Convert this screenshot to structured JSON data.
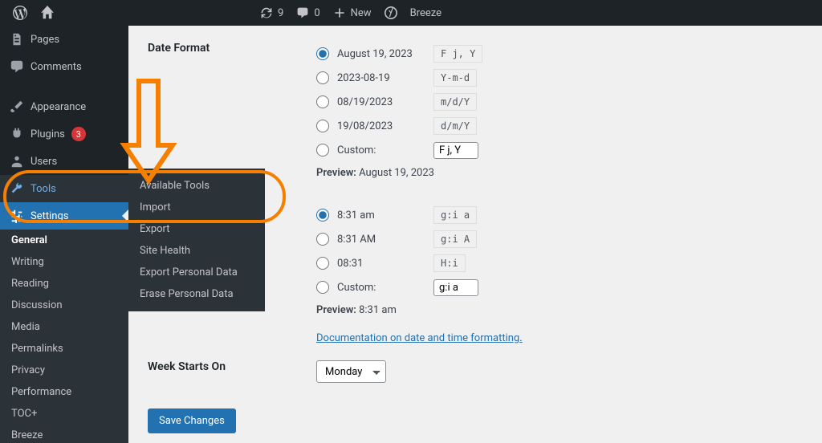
{
  "adminbar": {
    "updates_count": "9",
    "comments_count": "0",
    "new_label": "New",
    "yoast": "Y",
    "breeze": "Breeze"
  },
  "sidebar": {
    "pages": "Pages",
    "comments": "Comments",
    "appearance": "Appearance",
    "plugins": "Plugins",
    "plugins_badge": "3",
    "users": "Users",
    "tools": "Tools",
    "settings": "Settings",
    "sub": {
      "general": "General",
      "writing": "Writing",
      "reading": "Reading",
      "discussion": "Discussion",
      "media": "Media",
      "permalinks": "Permalinks",
      "privacy": "Privacy",
      "performance": "Performance",
      "tocplus": "TOC+",
      "breeze": "Breeze"
    }
  },
  "tools_flyout": {
    "available": "Available Tools",
    "import": "Import",
    "export": "Export",
    "site_health": "Site Health",
    "export_personal": "Export Personal Data",
    "erase_personal": "Erase Personal Data"
  },
  "content": {
    "date_format_label": "Date Format",
    "date_options": [
      {
        "display": "August 19, 2023",
        "code": "F j, Y",
        "checked": true
      },
      {
        "display": "2023-08-19",
        "code": "Y-m-d",
        "checked": false
      },
      {
        "display": "08/19/2023",
        "code": "m/d/Y",
        "checked": false
      },
      {
        "display": "19/08/2023",
        "code": "d/m/Y",
        "checked": false
      }
    ],
    "date_custom_label": "Custom:",
    "date_custom_value": "F j, Y",
    "date_preview_label": "Preview:",
    "date_preview_value": "August 19, 2023",
    "time_options": [
      {
        "display": "8:31 am",
        "code": "g:i a",
        "checked": true
      },
      {
        "display": "8:31 AM",
        "code": "g:i A",
        "checked": false
      },
      {
        "display": "08:31",
        "code": "H:i",
        "checked": false
      }
    ],
    "time_custom_label": "Custom:",
    "time_custom_value": "g:i a",
    "time_preview_label": "Preview:",
    "time_preview_value": "8:31 am",
    "doc_link": "Documentation on date and time formatting",
    "week_starts_label": "Week Starts On",
    "week_starts_value": "Monday",
    "save_btn": "Save Changes"
  }
}
